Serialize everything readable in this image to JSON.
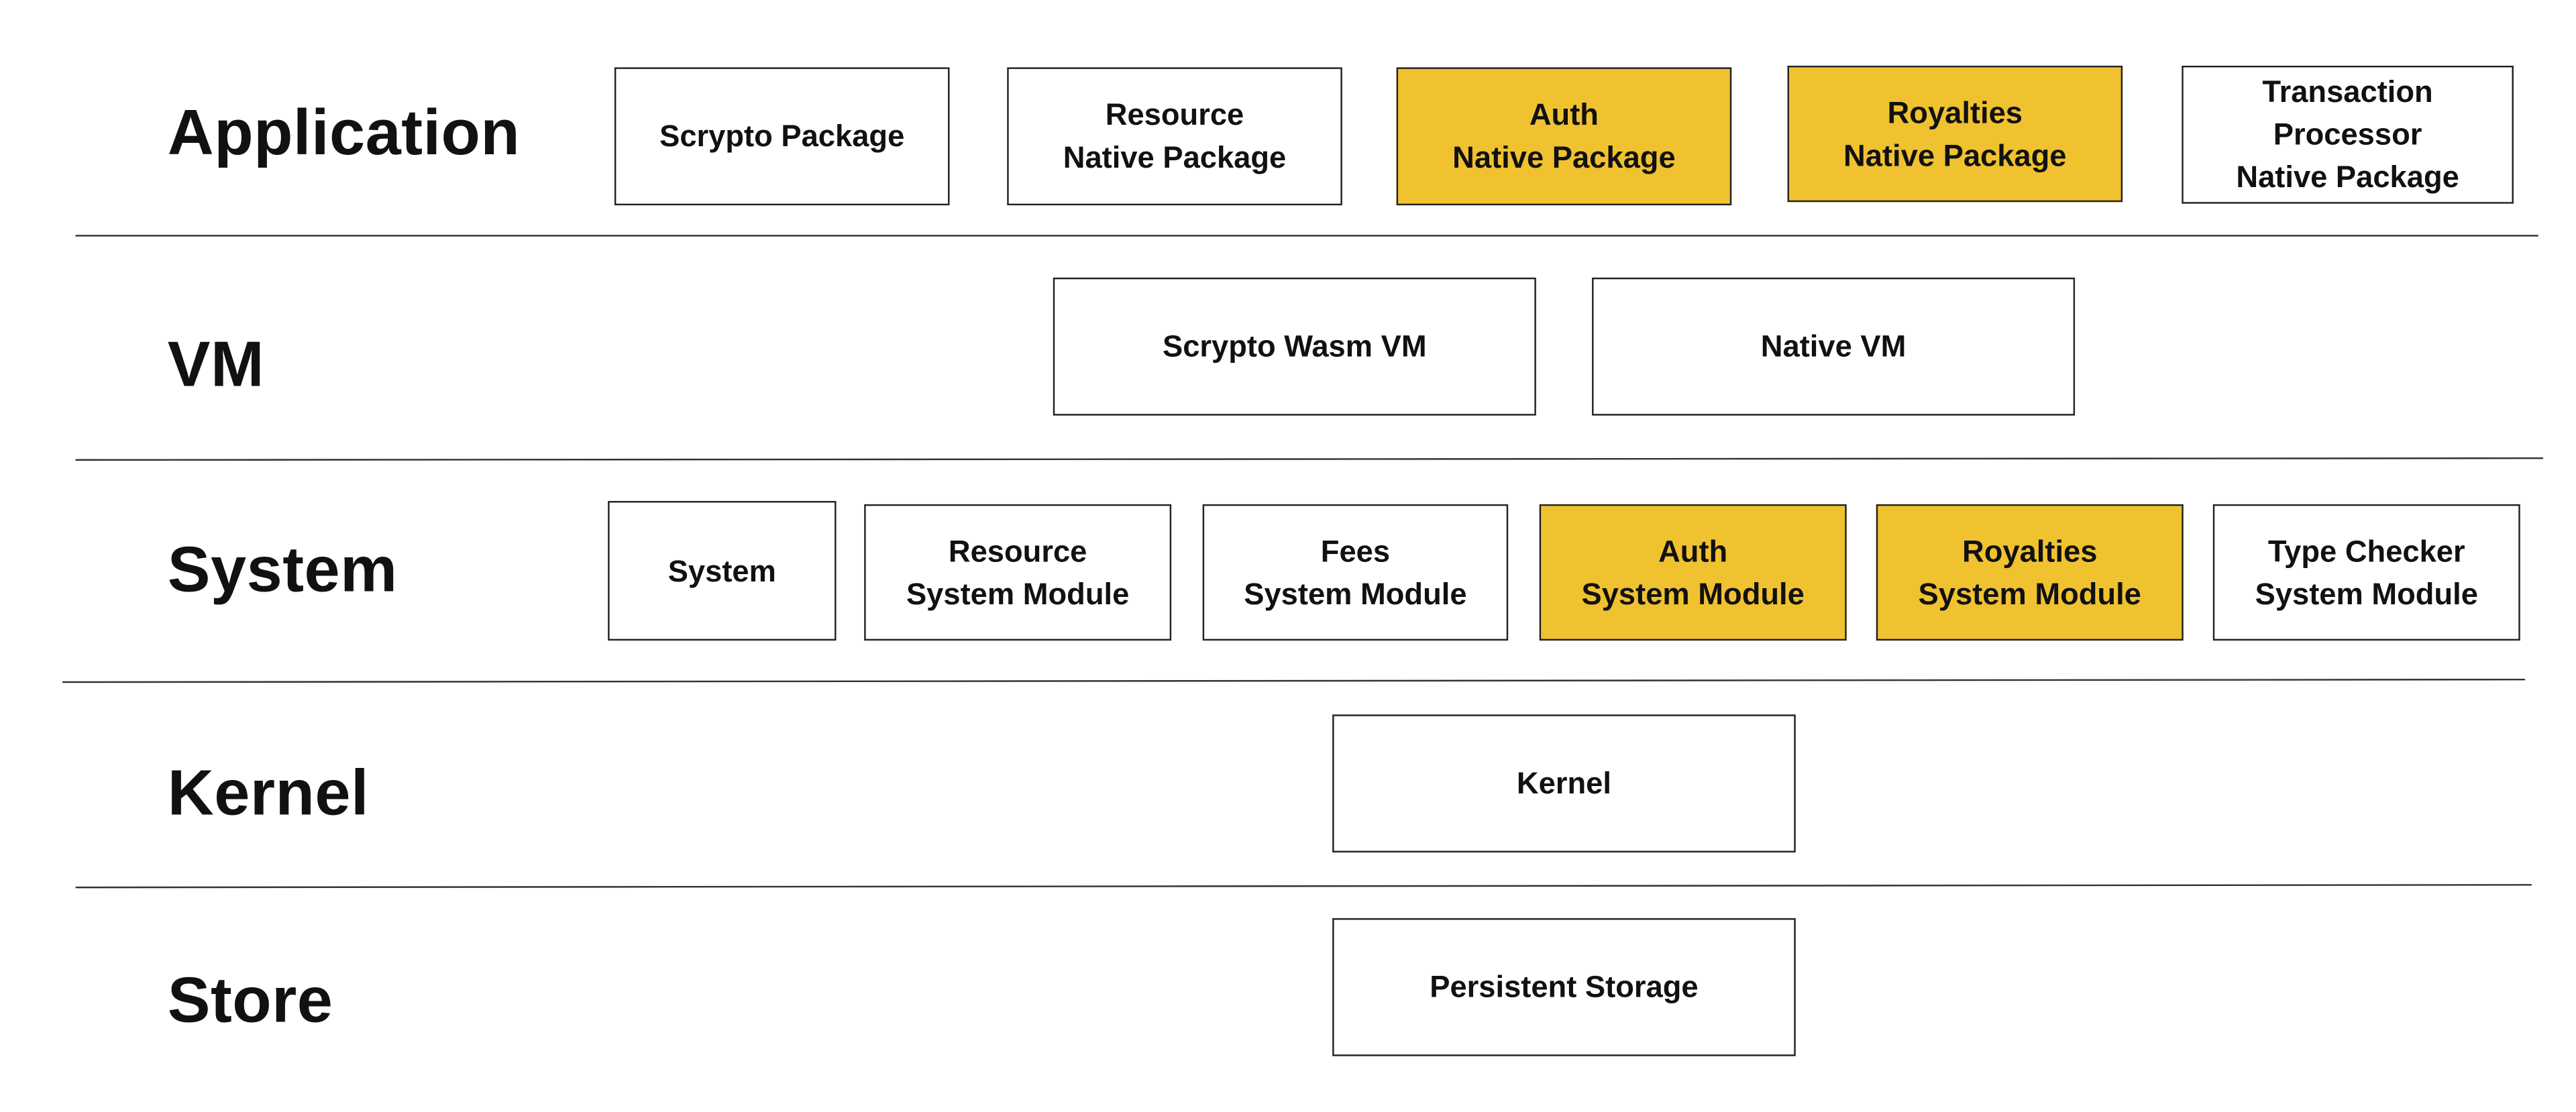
{
  "colors": {
    "highlight": "#f0c230",
    "border": "#222222",
    "background": "#ffffff"
  },
  "layers": [
    {
      "label": "Application",
      "boxes": [
        {
          "text": "Scrypto Package",
          "highlighted": false
        },
        {
          "text": "Resource\nNative Package",
          "highlighted": false
        },
        {
          "text": "Auth\nNative Package",
          "highlighted": true
        },
        {
          "text": "Royalties\nNative Package",
          "highlighted": true
        },
        {
          "text": "Transaction\nProcessor\nNative Package",
          "highlighted": false
        }
      ]
    },
    {
      "label": "VM",
      "boxes": [
        {
          "text": "Scrypto Wasm VM",
          "highlighted": false
        },
        {
          "text": "Native VM",
          "highlighted": false
        }
      ]
    },
    {
      "label": "System",
      "boxes": [
        {
          "text": "System",
          "highlighted": false
        },
        {
          "text": "Resource\nSystem Module",
          "highlighted": false
        },
        {
          "text": "Fees\nSystem Module",
          "highlighted": false
        },
        {
          "text": "Auth\nSystem Module",
          "highlighted": true
        },
        {
          "text": "Royalties\nSystem Module",
          "highlighted": true
        },
        {
          "text": "Type Checker\nSystem Module",
          "highlighted": false
        }
      ]
    },
    {
      "label": "Kernel",
      "boxes": [
        {
          "text": "Kernel",
          "highlighted": false
        }
      ]
    },
    {
      "label": "Store",
      "boxes": [
        {
          "text": "Persistent Storage",
          "highlighted": false
        }
      ]
    }
  ]
}
